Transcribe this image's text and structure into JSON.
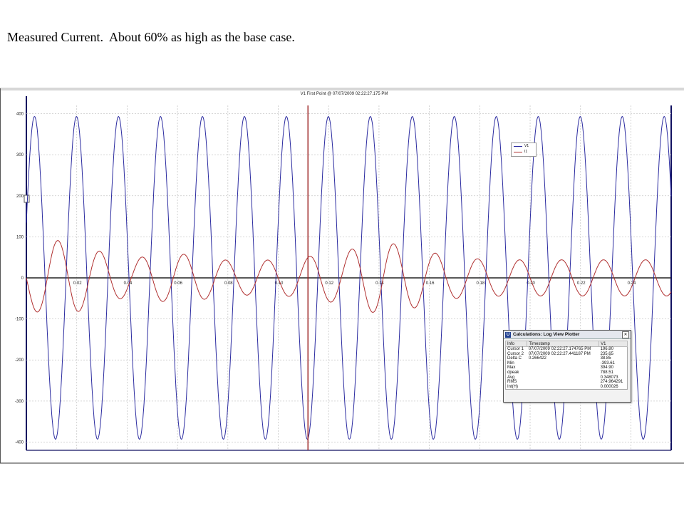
{
  "caption": "Measured Current.  About 60% as high as the base case.",
  "window": {
    "plot_title": "V1 First Point @ 07/07/2009 02:22:27.175 PM"
  },
  "colors": {
    "v1": "#2b2ba0",
    "i1": "#b03030",
    "cursor": "#9a1f1f",
    "axis": "#101060",
    "grid": "#c8c8c8"
  },
  "chart_data": {
    "type": "line",
    "title": "V1 First Point @ 07/07/2009 02:22:27.175 PM",
    "xlabel": "",
    "ylabel": "",
    "xlim": [
      0,
      0.256
    ],
    "ylim": [
      -420,
      420
    ],
    "grid": true,
    "legend_placement": "top-right",
    "x_ticks": [
      0.02,
      0.04,
      0.06,
      0.08,
      0.1,
      0.12,
      0.14,
      0.16,
      0.18,
      0.2,
      0.22,
      0.24
    ],
    "x_tick_labels": [
      "0.02",
      "0.04",
      "0.06",
      "0.08",
      "0.10",
      "0.12",
      "0.14",
      "0.16",
      "0.18",
      "0.20",
      "0.22",
      "0.24"
    ],
    "y_ticks": [
      400,
      300,
      200,
      100,
      0,
      -100,
      -200,
      -300,
      -400
    ],
    "y_tick_labels": [
      "400",
      "300",
      "200",
      "100",
      "0",
      "-100",
      "-200",
      "-300",
      "-400"
    ],
    "cursor_x": 0.1118,
    "series": [
      {
        "name": "V1",
        "waveform": "sine",
        "amplitude": 393,
        "frequency_hz": 60,
        "phase_deg": 20
      },
      {
        "name": "I1",
        "waveform": "sine",
        "frequency_hz": 60,
        "phase_deg": 180,
        "peak_amplitudes": [
          74,
          92,
          90,
          73,
          57,
          44,
          57,
          58,
          57,
          47,
          40,
          44,
          43,
          47,
          58,
          60,
          80,
          88,
          78,
          68,
          52,
          48,
          45,
          44
        ]
      }
    ]
  },
  "calc": {
    "title": "Calculations: Log View Plotter",
    "headers": [
      "Info",
      "Timestamp",
      "V1"
    ],
    "rows": [
      [
        "Cursor 1",
        "07/07/2009 02:22:27.174765 PM",
        "196.80"
      ],
      [
        "Cursor 2",
        "07/07/2009 02:22:27.441187 PM",
        "235.65"
      ],
      [
        "Delta C",
        "0.266422",
        "38.85"
      ],
      [
        "Min",
        "",
        "-393.61"
      ],
      [
        "Max",
        "",
        "394.90"
      ],
      [
        "dpeak",
        "",
        "788.51"
      ],
      [
        "Avg",
        "",
        "0.348073"
      ],
      [
        "RMS",
        "",
        "274.964291"
      ],
      [
        "Int(H)",
        "",
        "0.000026"
      ]
    ]
  }
}
